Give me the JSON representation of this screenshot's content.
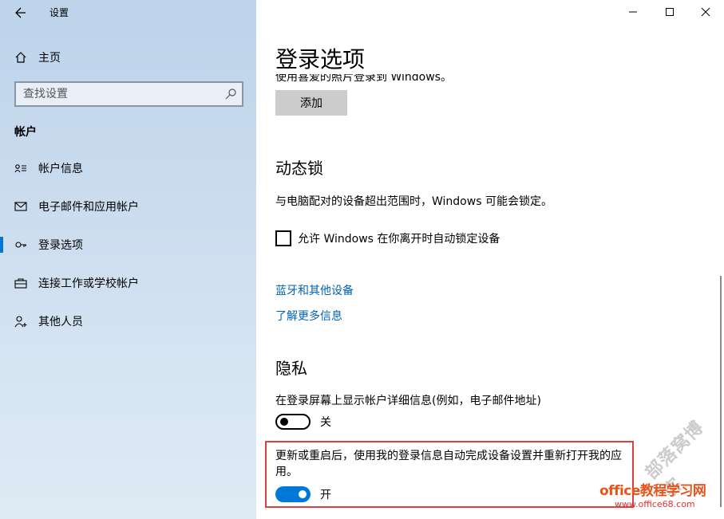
{
  "window": {
    "title": "设置"
  },
  "sidebar": {
    "home_label": "主页",
    "search_placeholder": "查找设置",
    "section_label": "帐户",
    "items": [
      {
        "label": "帐户信息",
        "icon": "account-info-icon"
      },
      {
        "label": "电子邮件和应用帐户",
        "icon": "mail-icon"
      },
      {
        "label": "登录选项",
        "icon": "key-icon",
        "active": true
      },
      {
        "label": "连接工作或学校帐户",
        "icon": "briefcase-icon"
      },
      {
        "label": "其他人员",
        "icon": "person-add-icon"
      }
    ]
  },
  "main": {
    "title": "登录选项",
    "clipped_text": "使用喜爱的照片登录到 Windows。",
    "add_button": "添加",
    "dynamic_lock": {
      "heading": "动态锁",
      "description": "与电脑配对的设备超出范围时，Windows 可能会锁定。",
      "checkbox_label": "允许 Windows 在你离开时自动锁定设备",
      "checked": false
    },
    "links": {
      "bluetooth": "蓝牙和其他设备",
      "learn_more": "了解更多信息"
    },
    "privacy": {
      "heading": "隐私",
      "show_details_label": "在登录屏幕上显示帐户详细信息(例如，电子邮件地址)",
      "show_details_state": "关",
      "auto_finish_label": "更新或重启后，使用我的登录信息自动完成设备设置并重新打开我的应用。",
      "auto_finish_state": "开"
    }
  },
  "watermark": {
    "main": "office教程学习网",
    "sub": "www.office68.com",
    "stamp": "部落窝博客"
  },
  "colors": {
    "accent": "#0078d7",
    "link": "#0063b1",
    "highlight": "#e03c3c",
    "watermark": "#e8541a"
  }
}
